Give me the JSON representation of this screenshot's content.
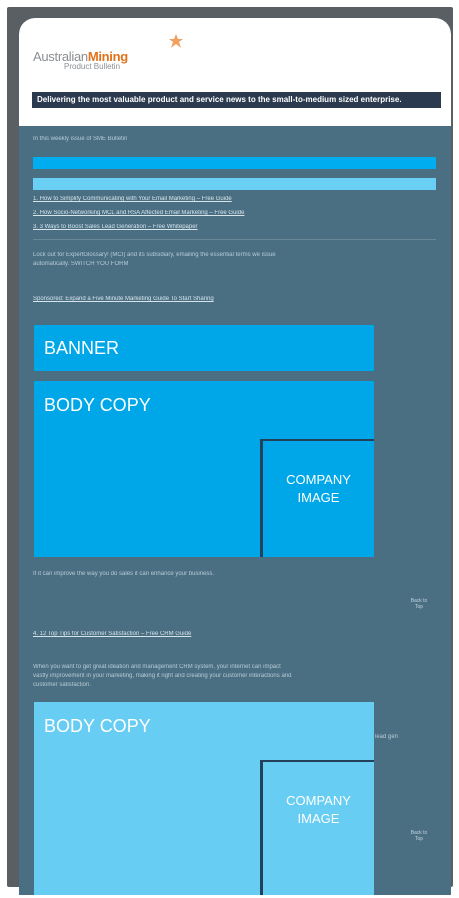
{
  "header": {
    "logo": {
      "word_a": "Australian",
      "word_b": "Mining",
      "sub": "Product Bulletin",
      "mark_icon": "mining-logo-mark"
    },
    "tagline": "Delivering the most valuable product and service news to the small-to-medium sized enterprise."
  },
  "blurred": {
    "intro_line": "In this weekly issue of SME Bulletin",
    "toc": [
      "1.  How to Simplify Communicating with Your Email Marketing – Free Guide",
      "2.  How Socio-Networking MCL and RSA Affected Email Marketing – Free Guide",
      "3.  3 Ways to Boost Sales Lead Generation – Free Whitepaper"
    ],
    "para1a": "Lock out for ExpertGlossary! (MCI) and its subsidiary, emailing the essential terms we issue",
    "para1b": "automatically. SWITCH YOU FORM",
    "sponsor": "Sponsored: Expand a Five Minute Marketing Guide To Start Sharing",
    "caption1": "If it can improve the way you do sales it can enhance your business.",
    "back_label": "Back to Top",
    "section2_title": "4. 12 Top Tips for Customer Satisfaction – Free CRM Guide",
    "para2a": "When you want to get great ideation and management CRM system, your internet can impact",
    "para2b": "vastly improvement in your marketing, making it right and creating your customer interactions and",
    "para2c": "customer satisfaction.",
    "snip": "lead gen"
  },
  "blocks": {
    "banner_label": "BANNER",
    "body_copy_label": "BODY COPY",
    "company_image_label_line1": "COMPANY",
    "company_image_label_line2": "IMAGE"
  },
  "colors": {
    "frame": "#5a5f63",
    "email_bg": "#4a6f83",
    "tagline_bg": "#2b3a4f",
    "logo_orange": "#e0731c",
    "bar_bright": "#00aeef",
    "bar_light": "#69cff5",
    "block_blue": "#00a7e8",
    "block_light": "#68cdf3"
  }
}
